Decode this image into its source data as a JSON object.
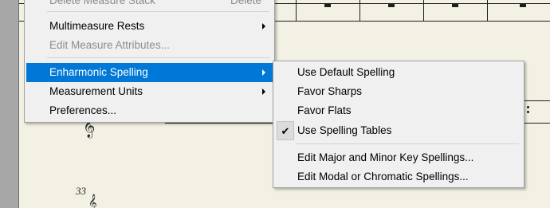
{
  "main_menu": {
    "items": [
      {
        "label": "Delete Measure Stack",
        "shortcut": "Delete"
      },
      {
        "label": "Multimeasure Rests"
      },
      {
        "label": "Edit Measure Attributes..."
      },
      {
        "label": "Enharmonic Spelling"
      },
      {
        "label": "Measurement Units"
      },
      {
        "label": "Preferences..."
      }
    ]
  },
  "submenu": {
    "title": "Enharmonic Spelling",
    "items": [
      {
        "label": "Use Default Spelling",
        "checked": false
      },
      {
        "label": "Favor Sharps",
        "checked": false
      },
      {
        "label": "Favor Flats",
        "checked": false
      },
      {
        "label": "Use Spelling Tables",
        "checked": true
      },
      {
        "label": "Edit Major and Minor Key Spellings...",
        "checked": false
      },
      {
        "label": "Edit Modal or Chromatic Spellings...",
        "checked": false
      }
    ]
  },
  "score": {
    "measure_number": "33",
    "clef_icon": "treble-clef-icon"
  },
  "colors": {
    "highlight": "#0078d7",
    "menu_background": "#f0f0f0",
    "disabled_text": "#8d8d8d",
    "paper": "#f3f1e3"
  }
}
